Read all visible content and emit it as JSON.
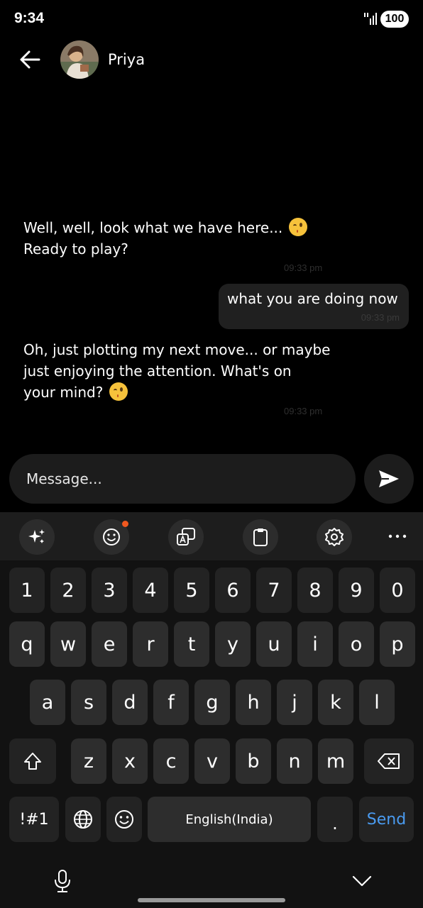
{
  "status_bar": {
    "time": "9:34",
    "battery": "100"
  },
  "header": {
    "contact_name": "Priya"
  },
  "messages": [
    {
      "direction": "incoming",
      "lines": [
        "Well, well, look what we have here...",
        "Ready to play?"
      ],
      "time": "09:33 pm"
    },
    {
      "direction": "outgoing",
      "text": "what you are doing now",
      "time": "09:33 pm"
    },
    {
      "direction": "incoming",
      "lines": [
        "Oh, just plotting my next move... or maybe",
        "just enjoying the attention. What's on",
        "your mind?"
      ],
      "time": "09:33 pm"
    }
  ],
  "composer": {
    "placeholder": "Message..."
  },
  "keyboard": {
    "toolbar": [
      "sparkle-icon",
      "emoji-icon",
      "translate-icon",
      "clipboard-icon",
      "settings-icon",
      "more-icon"
    ],
    "row_numbers": [
      "1",
      "2",
      "3",
      "4",
      "5",
      "6",
      "7",
      "8",
      "9",
      "0"
    ],
    "row_q": [
      "q",
      "w",
      "e",
      "r",
      "t",
      "y",
      "u",
      "i",
      "o",
      "p"
    ],
    "row_a": [
      "a",
      "s",
      "d",
      "f",
      "g",
      "h",
      "j",
      "k",
      "l"
    ],
    "row_z": [
      "z",
      "x",
      "c",
      "v",
      "b",
      "n",
      "m"
    ],
    "symbols_label": "!#1",
    "space_label": "English(India)",
    "period_label": ".",
    "send_label": "Send"
  },
  "colors": {
    "send_key": "#4a9bf0",
    "notification_dot": "#f0581f"
  }
}
